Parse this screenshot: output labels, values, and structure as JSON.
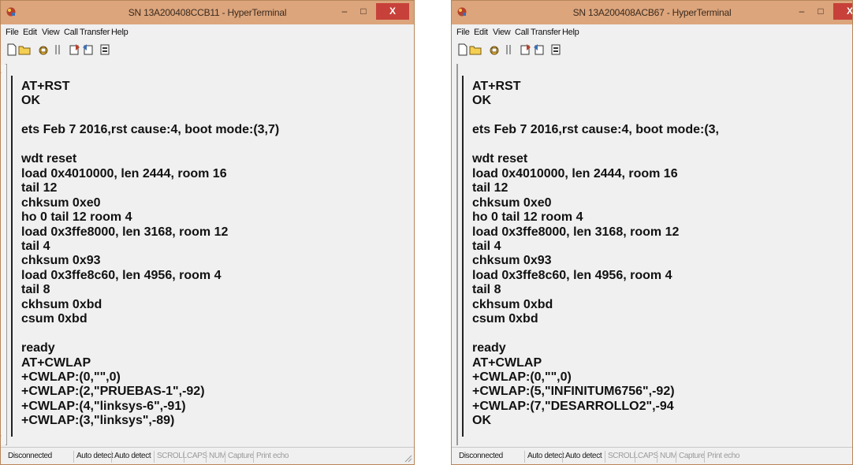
{
  "windows": [
    {
      "title": "SN 13A200408CCB11 - HyperTerminal",
      "close_label": "X",
      "menu": [
        "File",
        "Edit",
        "View",
        "Call",
        "Transfer",
        "Help"
      ],
      "toolbar_icons": [
        "new-document-icon",
        "open-folder-icon",
        "connect-phone-icon",
        "disconnect-phone-icon",
        "send-icon",
        "receive-icon",
        "properties-icon"
      ],
      "terminal_lines": [
        "AT+RST",
        "OK",
        "",
        "ets Feb 7 2016,rst cause:4, boot mode:(3,7)",
        "",
        "wdt reset",
        "load 0x4010000, len 2444, room 16",
        "tail 12",
        "chksum 0xe0",
        "ho 0 tail 12 room 4",
        "load 0x3ffe8000, len 3168, room 12",
        "tail 4",
        "chksum 0x93",
        "load 0x3ffe8c60, len 4956, room 4",
        "tail 8",
        "ckhsum 0xbd",
        "csum 0xbd",
        "",
        "ready",
        "AT+CWLAP",
        "+CWLAP:(0,\"\",0)",
        "+CWLAP:(2,\"PRUEBAS-1\",-92)",
        "+CWLAP:(4,\"linksys-6\",-91)",
        "+CWLAP:(3,\"linksys\",-89)"
      ],
      "status": [
        "Disconnected",
        "Auto detect",
        "Auto detect",
        "SCROLL",
        "CAPS",
        "NUM",
        "Capture",
        "Print echo"
      ]
    },
    {
      "title": "SN 13A200408ACB67 - HyperTerminal",
      "close_label": "X",
      "menu": [
        "File",
        "Edit",
        "View",
        "Call",
        "Transfer",
        "Help"
      ],
      "toolbar_icons": [
        "new-document-icon",
        "open-folder-icon",
        "connect-phone-icon",
        "disconnect-phone-icon",
        "send-icon",
        "receive-icon",
        "properties-icon"
      ],
      "terminal_lines": [
        "AT+RST",
        "OK",
        "",
        "ets Feb 7 2016,rst cause:4, boot mode:(3,",
        "",
        "wdt reset",
        "load 0x4010000, len 2444, room 16",
        "tail 12",
        "chksum 0xe0",
        "ho 0 tail 12 room 4",
        "load 0x3ffe8000, len 3168, room 12",
        "tail 4",
        "chksum 0x93",
        "load 0x3ffe8c60, len 4956, room 4",
        "tail 8",
        "ckhsum 0xbd",
        "csum 0xbd",
        "",
        "ready",
        "AT+CWLAP",
        "+CWLAP:(0,\"\",0)",
        "+CWLAP:(5,\"INFINITUM6756\",-92)",
        "+CWLAP:(7,\"DESARROLLO2\",-94",
        "OK"
      ],
      "status": [
        "Disconnected",
        "Auto detect",
        "Auto detect",
        "SCROLL",
        "CAPS",
        "NUM",
        "Capture",
        "Print echo"
      ]
    }
  ],
  "colors": {
    "titlebar": "#dca57c",
    "close_button": "#c7413a",
    "status_inactive": "#9a9a9a"
  }
}
